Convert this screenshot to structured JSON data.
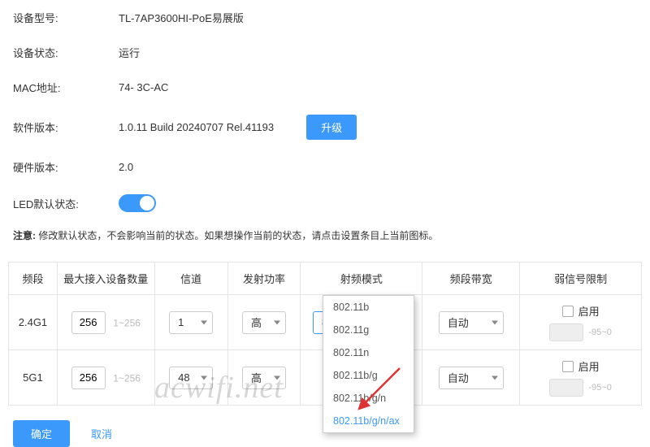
{
  "info": {
    "model_label": "设备型号:",
    "model_value": "TL-7AP3600HI-PoE易展版",
    "status_label": "设备状态:",
    "status_value": "运行",
    "mac_label": "MAC地址:",
    "mac_value": "74-            3C-AC",
    "sw_label": "软件版本:",
    "sw_value": "1.0.11 Build 20240707 Rel.41193",
    "upgrade_btn": "升级",
    "hw_label": "硬件版本:",
    "hw_value": "2.0",
    "led_label": "LED默认状态:"
  },
  "note": {
    "prefix": "注意:",
    "text": " 修改默认状态，不会影响当前的状态。如果想操作当前的状态，请点击设置条目上当前图标。"
  },
  "table": {
    "headers": {
      "band": "频段",
      "max": "最大接入设备数量",
      "channel": "信道",
      "power": "发射功率",
      "rf": "射频模式",
      "bw": "频段带宽",
      "weak": "弱信号限制"
    },
    "rows": [
      {
        "band": "2.4G1",
        "max_value": "256",
        "max_range": "1~256",
        "channel": "1",
        "power": "高",
        "rf": "802.11b/g/n/ax",
        "bw": "自动",
        "weak_label": "启用",
        "weak_hint": "-95~0"
      },
      {
        "band": "5G1",
        "max_value": "256",
        "max_range": "1~256",
        "channel": "48",
        "power": "高",
        "rf": "",
        "bw": "自动",
        "weak_label": "启用",
        "weak_hint": "-95~0"
      }
    ]
  },
  "rf_dropdown": {
    "items": [
      "802.11b",
      "802.11g",
      "802.11n",
      "802.11b/g",
      "802.11b/g/n",
      "802.11b/g/n/ax"
    ],
    "selected_index": 5
  },
  "actions": {
    "confirm": "确定",
    "cancel": "取消"
  },
  "watermark": "acwifi.net"
}
